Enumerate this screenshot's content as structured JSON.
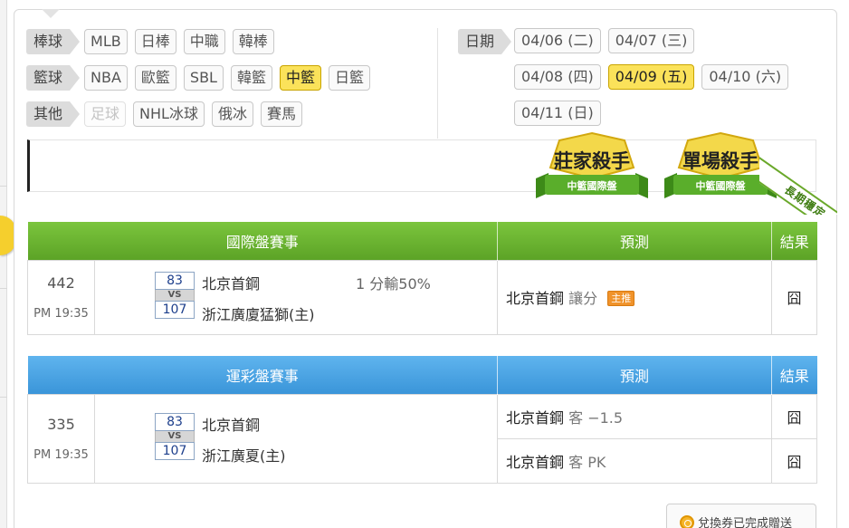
{
  "filters": {
    "rows": [
      {
        "label": "棒球",
        "items": [
          {
            "text": "MLB",
            "state": "normal"
          },
          {
            "text": "日棒",
            "state": "normal"
          },
          {
            "text": "中職",
            "state": "normal"
          },
          {
            "text": "韓棒",
            "state": "normal"
          }
        ]
      },
      {
        "label": "籃球",
        "items": [
          {
            "text": "NBA",
            "state": "normal"
          },
          {
            "text": "歐籃",
            "state": "normal"
          },
          {
            "text": "SBL",
            "state": "normal"
          },
          {
            "text": "韓籃",
            "state": "normal"
          },
          {
            "text": "中籃",
            "state": "active"
          },
          {
            "text": "日籃",
            "state": "normal"
          }
        ]
      },
      {
        "label": "其他",
        "items": [
          {
            "text": "足球",
            "state": "disabled"
          },
          {
            "text": "NHL冰球",
            "state": "normal"
          },
          {
            "text": "俄冰",
            "state": "normal"
          },
          {
            "text": "賽馬",
            "state": "normal"
          }
        ]
      }
    ]
  },
  "dates": {
    "label": "日期",
    "lines": [
      [
        {
          "text": "04/06 (二)",
          "state": "normal"
        },
        {
          "text": "04/07 (三)",
          "state": "normal"
        }
      ],
      [
        {
          "text": "04/08 (四)",
          "state": "normal"
        },
        {
          "text": "04/09 (五)",
          "state": "active"
        },
        {
          "text": "04/10 (六)",
          "state": "normal"
        }
      ],
      [
        {
          "text": "04/11 (日)",
          "state": "normal"
        }
      ]
    ]
  },
  "badges": {
    "badge1": {
      "title": "莊家殺手",
      "subtitle": "中籃國際盤"
    },
    "badge2": {
      "title": "單場殺手",
      "subtitle": "中籃國際盤"
    },
    "ribbon": "長期穩定"
  },
  "international": {
    "headers": {
      "event": "國際盤賽事",
      "prediction": "預測",
      "result": "結果"
    },
    "game": {
      "id": "442",
      "time": "PM 19:35",
      "away_score": "83",
      "home_score": "107",
      "vs": "VS",
      "away_team": "北京首鋼",
      "home_team": "浙江廣廈猛獅(主)",
      "spread": "1 分輸50%",
      "prediction_team": "北京首鋼",
      "prediction_pick": "讓分",
      "prediction_tag": "主推",
      "result": "囧"
    }
  },
  "sports_lottery": {
    "headers": {
      "event": "運彩盤賽事",
      "prediction": "預測",
      "result": "結果"
    },
    "game": {
      "id": "335",
      "time": "PM 19:35",
      "away_score": "83",
      "home_score": "107",
      "vs": "VS",
      "away_team": "北京首鋼",
      "home_team": "浙江廣夏(主)",
      "predictions": [
        {
          "team": "北京首鋼",
          "pick": "客 −1.5",
          "result": "囧"
        },
        {
          "team": "北京首鋼",
          "pick": "客 PK",
          "result": "囧"
        }
      ]
    }
  },
  "notice": {
    "text": "兌換券已完成贈送"
  },
  "colors": {
    "active_chip": "#fbe25a",
    "intl_header": "#6ab531",
    "sport_header": "#4aa3e3",
    "tag": "#f0932b"
  }
}
